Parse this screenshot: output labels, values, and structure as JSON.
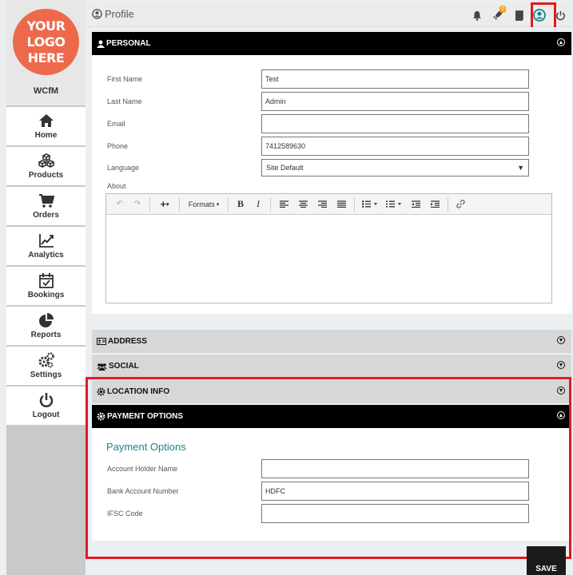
{
  "sidebar": {
    "logo_lines": [
      "YOUR",
      "LOGO",
      "HERE"
    ],
    "store_name": "WCfM",
    "items": [
      {
        "label": "Home",
        "icon": "home-icon"
      },
      {
        "label": "Products",
        "icon": "cubes-icon"
      },
      {
        "label": "Orders",
        "icon": "cart-icon"
      },
      {
        "label": "Analytics",
        "icon": "chart-icon"
      },
      {
        "label": "Bookings",
        "icon": "calendar-icon"
      },
      {
        "label": "Reports",
        "icon": "pie-chart-icon"
      },
      {
        "label": "Settings",
        "icon": "cogs-icon"
      },
      {
        "label": "Logout",
        "icon": "power-icon"
      }
    ]
  },
  "header": {
    "title": "Profile",
    "icons": [
      "bell-icon",
      "rocket-icon",
      "book-icon",
      "profile-icon",
      "power-icon"
    ],
    "notification_badge": "0"
  },
  "personal": {
    "title": "PERSONAL",
    "fields": [
      {
        "label": "First Name",
        "value": "Test"
      },
      {
        "label": "Last Name",
        "value": "Admin"
      },
      {
        "label": "Email",
        "value": ""
      },
      {
        "label": "Phone",
        "value": "7412589630"
      }
    ],
    "language_label": "Language",
    "language_value": "Site Default",
    "about_label": "About",
    "editor_formats": "Formats"
  },
  "sections": {
    "address": "ADDRESS",
    "social": "SOCIAL",
    "location": "LOCATION INFO",
    "payment": "PAYMENT OPTIONS"
  },
  "payment": {
    "heading": "Payment Options",
    "fields": [
      {
        "label": "Account Holder Name",
        "value": ""
      },
      {
        "label": "Bank Account Number",
        "value": "HDFC"
      },
      {
        "label": "IFSC Code",
        "value": ""
      }
    ]
  },
  "save_label": "SAVE",
  "colors": {
    "logo": "#ec6a4b",
    "accent_teal": "#17868c",
    "highlight_red": "#e21a23"
  }
}
